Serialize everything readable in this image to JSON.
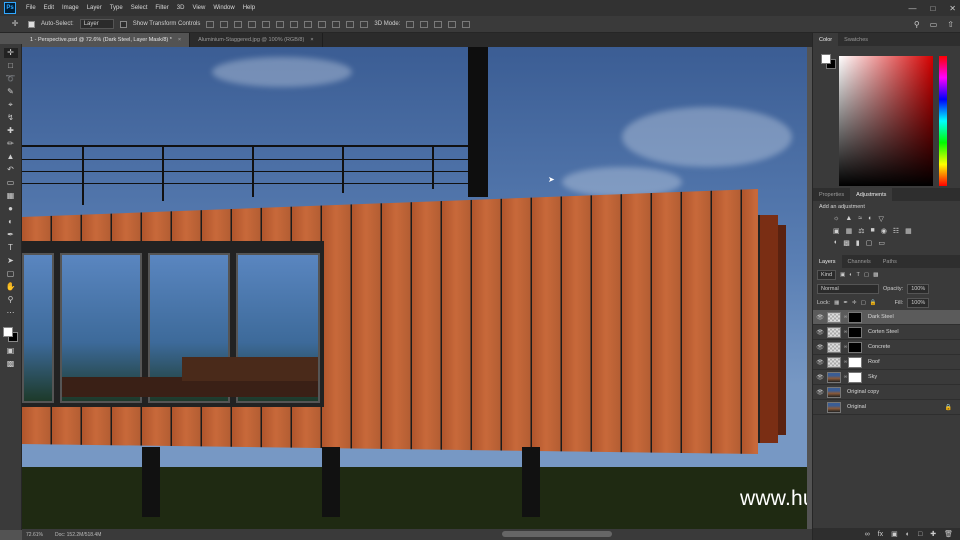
{
  "menubar": {
    "app_logo": "Ps",
    "items": [
      "File",
      "Edit",
      "Image",
      "Layer",
      "Type",
      "Select",
      "Filter",
      "3D",
      "View",
      "Window",
      "Help"
    ]
  },
  "options": {
    "auto_select_label": "Auto-Select:",
    "auto_select_target": "Layer",
    "transform_label": "Show Transform Controls",
    "mode_label": "3D Mode:"
  },
  "tabs": [
    {
      "label": "1 - Perspective.psd @ 72.6% (Dark Steel, Layer Mask/8) *",
      "active": true
    },
    {
      "label": "Aluminium-Staggered.jpg @ 100% (RGB/8)",
      "active": false
    }
  ],
  "status": {
    "zoom": "72.61%",
    "doc": "Doc: 152.2M/518.4M"
  },
  "watermark": "www.hunls.com",
  "panels": {
    "color_tabs": [
      "Color",
      "Swatches"
    ],
    "adjust_tabs": [
      "Properties",
      "Adjustments"
    ],
    "adjust_title": "Add an adjustment",
    "layer_tabs": [
      "Layers",
      "Channels",
      "Paths"
    ],
    "kind_label": "Kind",
    "blend_mode": "Normal",
    "opacity_label": "Opacity:",
    "opacity_value": "100%",
    "lock_label": "Lock:",
    "fill_label": "Fill:",
    "fill_value": "100%",
    "layers": [
      {
        "name": "Dark Steel",
        "mask": "black",
        "selected": true,
        "visible": true,
        "locked": false
      },
      {
        "name": "Corten Steel",
        "mask": "black",
        "selected": false,
        "visible": true,
        "locked": false
      },
      {
        "name": "Concrete",
        "mask": "black",
        "selected": false,
        "visible": true,
        "locked": false
      },
      {
        "name": "Roof",
        "mask": "white",
        "selected": false,
        "visible": true,
        "locked": false
      },
      {
        "name": "Sky",
        "mask": "white",
        "selected": false,
        "visible": true,
        "locked": false
      },
      {
        "name": "Original copy",
        "mask": "",
        "selected": false,
        "visible": true,
        "locked": false
      },
      {
        "name": "Original",
        "mask": "",
        "selected": false,
        "visible": false,
        "locked": true
      }
    ]
  },
  "colors": {
    "app_bg": "#535353",
    "panel_bg": "#3a3a3a",
    "accent": "#31a8ff",
    "corten": "#c8693a"
  }
}
